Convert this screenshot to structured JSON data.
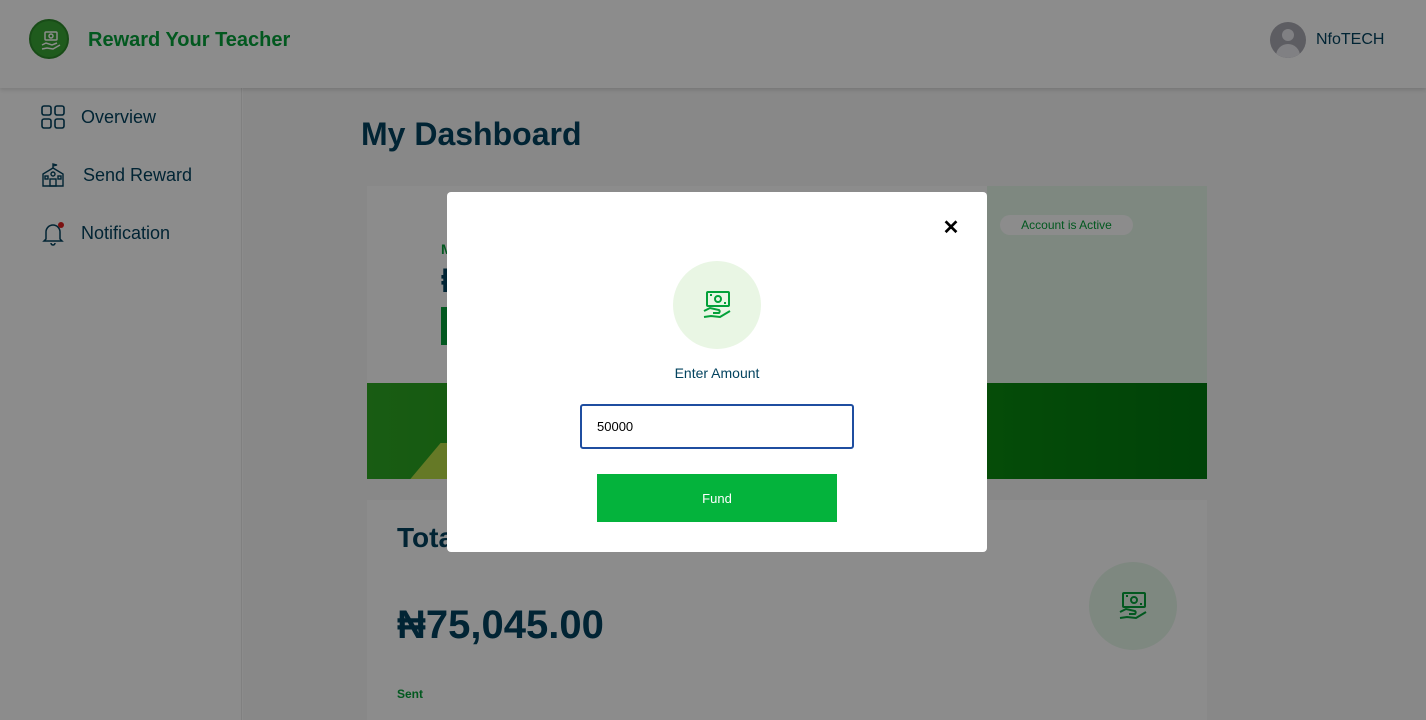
{
  "header": {
    "brand": "Reward Your Teacher",
    "logo_icon": "hand-money-icon",
    "user_name": "NfoTECH",
    "avatar_icon": "user-avatar-icon"
  },
  "sidebar": {
    "items": [
      {
        "label": "Overview",
        "icon": "grid-icon"
      },
      {
        "label": "Send Reward",
        "icon": "school-icon"
      },
      {
        "label": "Notification",
        "icon": "bell-icon"
      }
    ]
  },
  "main": {
    "page_title": "My Dashboard",
    "account_status": "Account is Active",
    "total_title": "Total",
    "total_amount": "₦75,045.00",
    "sent_label": "Sent"
  },
  "modal": {
    "label": "Enter Amount",
    "amount_value": "50000",
    "fund_label": "Fund",
    "close_glyph": "✕"
  },
  "colors": {
    "brand_green": "#04a13a",
    "fund_button": "#04b33c",
    "text_navy": "#03435f",
    "input_border": "#1f4ea0"
  }
}
